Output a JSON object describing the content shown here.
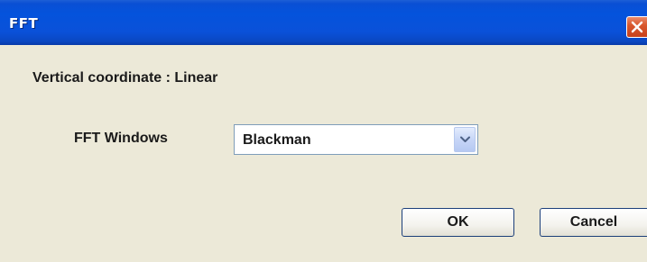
{
  "window": {
    "title": "FFT",
    "close_icon": "close-icon"
  },
  "content": {
    "vertical_coordinate_label": "Vertical coordinate : Linear",
    "fft_windows_label": "FFT Windows",
    "fft_windows_select": {
      "selected": "Blackman",
      "dropdown_icon": "chevron-down-icon"
    }
  },
  "buttons": {
    "ok_label": "OK",
    "cancel_label": "Cancel"
  },
  "colors": {
    "titlebar": "#0453dc",
    "client_background": "#ece9d8",
    "close_button": "#d9582e",
    "button_border": "#1c3f7a"
  }
}
